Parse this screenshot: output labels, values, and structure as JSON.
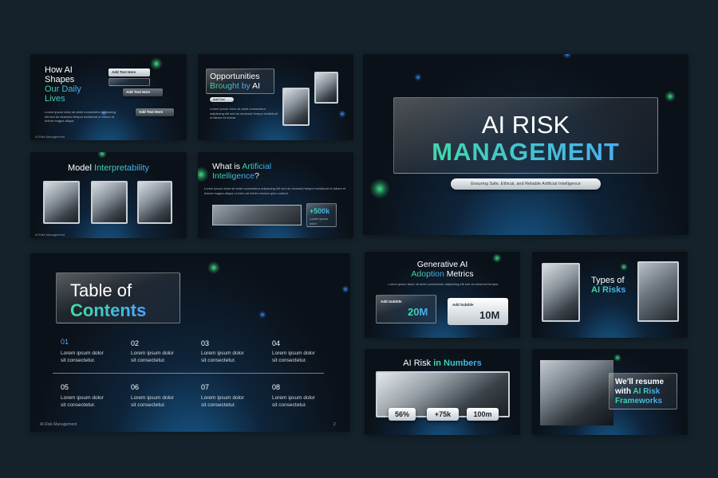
{
  "slide1": {
    "title_lines": [
      "How AI",
      "Shapes"
    ],
    "title_accent_lines": [
      "Our Daily",
      "Lives"
    ],
    "chips": [
      "Add Text Here",
      "Add Text Here",
      "Add Text Here"
    ],
    "footer": "AI Risk Management"
  },
  "slide2": {
    "title": "Opportunities",
    "title_accent": "Brought by",
    "title_tail": "AI",
    "button": "Add Text Here"
  },
  "slide3": {
    "title": "Model",
    "title_accent": "Interpretability"
  },
  "slide4": {
    "title": "What is",
    "title_accent_1": "Artificial",
    "title_accent_2": "Intelligence",
    "title_tail": "?",
    "stat": "+500k"
  },
  "hero": {
    "title_1": "AI RISK",
    "title_2": "MANAGEMENT",
    "subtitle": "Ensuring Safe, Ethical, and Reliable Artificial Intelligence"
  },
  "toc": {
    "title_1": "Table of",
    "title_2": "Contents",
    "items": [
      {
        "num": "01",
        "line1": "Lorem ipsum dolor",
        "line2": "sit consectetur."
      },
      {
        "num": "02",
        "line1": "Lorem ipsum dolor",
        "line2": "sit consectetur."
      },
      {
        "num": "03",
        "line1": "Lorem ipsum dolor",
        "line2": "sit consectetur."
      },
      {
        "num": "04",
        "line1": "Lorem ipsum dolor",
        "line2": "sit consectetur."
      },
      {
        "num": "05",
        "line1": "Lorem ipsum dolor",
        "line2": "sit consectetur."
      },
      {
        "num": "06",
        "line1": "Lorem ipsum dolor",
        "line2": "sit consectetur."
      },
      {
        "num": "07",
        "line1": "Lorem ipsum dolor",
        "line2": "sit consectetur."
      },
      {
        "num": "08",
        "line1": "Lorem ipsum dolor",
        "line2": "sit consectetur."
      }
    ],
    "footer": "AI Risk Management",
    "page": "2"
  },
  "adoption": {
    "title_1": "Generative AI",
    "title_accent": "Adoption",
    "title_tail": "Metrics",
    "card1_label": "Add Subtitle",
    "card1_value": "20M",
    "card2_label": "Add Subtitle",
    "card2_value": "10M"
  },
  "types": {
    "title_1": "Types of",
    "title_accent": "AI Risks"
  },
  "numbers": {
    "title": "AI Risk",
    "title_accent": "in Numbers",
    "stats": [
      "56%",
      "+75k",
      "100m"
    ]
  },
  "resume": {
    "title_1": "We'll resume",
    "title_2": "with",
    "title_accent_1": "AI Risk",
    "title_accent_2": "Frameworks"
  },
  "colors": {
    "background": "#15222b",
    "accent_green": "#3fe0a0",
    "accent_blue": "#4aa7ff"
  }
}
